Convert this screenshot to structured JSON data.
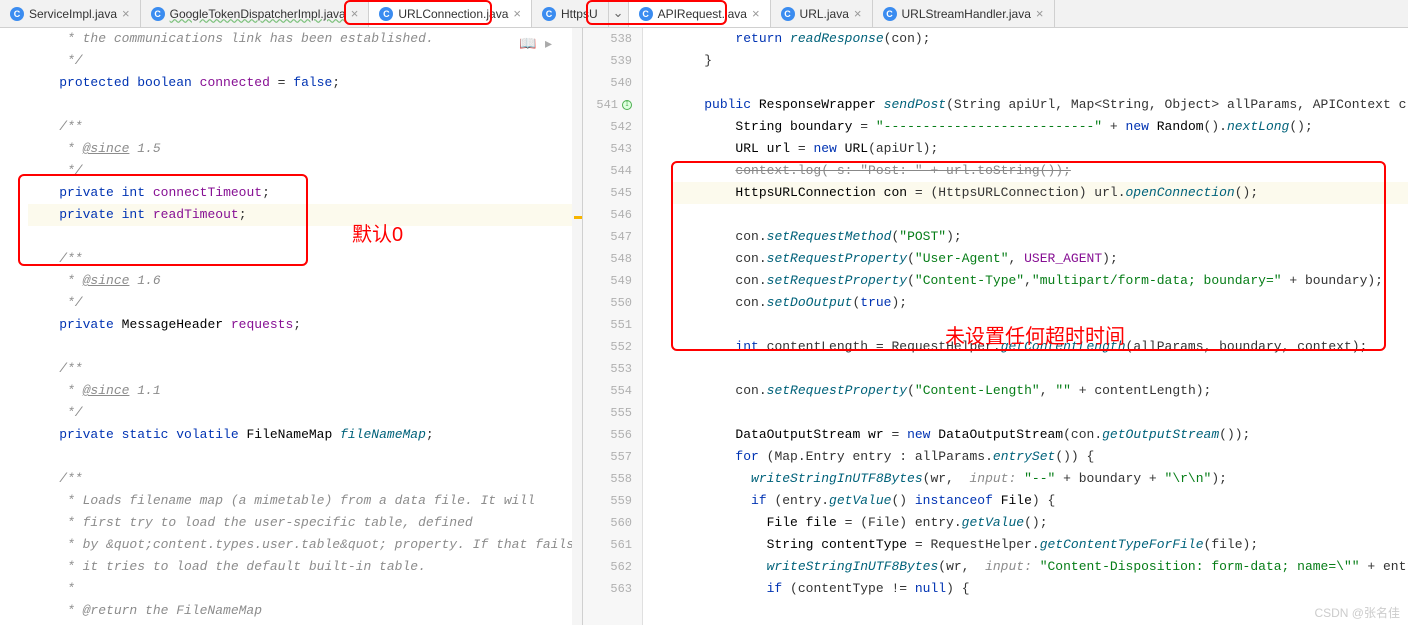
{
  "tabs_left": [
    {
      "label": "ServiceImpl.java",
      "active": false,
      "icon": "c"
    },
    {
      "label": "GoogleTokenDispatcherImpl.java",
      "active": false,
      "icon": "c",
      "underline": true
    },
    {
      "label": "URLConnection.java",
      "active": true,
      "icon": "c"
    },
    {
      "label": "HttpsU",
      "active": false,
      "icon": "c",
      "truncated": true
    }
  ],
  "tabs_right": [
    {
      "label": "APIRequest.java",
      "active": true,
      "icon": "c"
    },
    {
      "label": "URL.java",
      "active": false,
      "icon": "c"
    },
    {
      "label": "URLStreamHandler.java",
      "active": false,
      "icon": "c"
    }
  ],
  "annotation_left": "默认0",
  "annotation_right": "未设置任何超时时间",
  "watermark": "CSDN @张名佳",
  "right_lines": {
    "start": 538,
    "end": 563
  },
  "left_code": [
    {
      "t": "cmt",
      "text": "     * the communications link has been established."
    },
    {
      "t": "cmt",
      "text": "     */"
    },
    {
      "t": "code",
      "segs": [
        [
          "sp",
          "    "
        ],
        [
          "kw",
          "protected boolean"
        ],
        [
          "sp",
          " "
        ],
        [
          "fld",
          "connected"
        ],
        [
          "pl",
          " = "
        ],
        [
          "kw",
          "false"
        ],
        [
          "pl",
          ";"
        ]
      ]
    },
    {
      "t": "blank",
      "text": ""
    },
    {
      "t": "cmt",
      "text": "    /**"
    },
    {
      "t": "cmt",
      "text": "     * @since 1.5",
      "underline": "@since"
    },
    {
      "t": "cmt",
      "text": "     */"
    },
    {
      "t": "code",
      "segs": [
        [
          "sp",
          "    "
        ],
        [
          "kw",
          "private int"
        ],
        [
          "sp",
          " "
        ],
        [
          "fld",
          "connectTimeout"
        ],
        [
          "pl",
          ";"
        ]
      ]
    },
    {
      "t": "code",
      "segs": [
        [
          "sp",
          "    "
        ],
        [
          "kw",
          "private int"
        ],
        [
          "sp",
          " "
        ],
        [
          "fld",
          "readTimeout"
        ],
        [
          "pl",
          ";"
        ]
      ],
      "cursor": true,
      "hl": true
    },
    {
      "t": "blank",
      "text": ""
    },
    {
      "t": "cmt",
      "text": "    /**"
    },
    {
      "t": "cmt",
      "text": "     * @since 1.6",
      "underline": "@since"
    },
    {
      "t": "cmt",
      "text": "     */"
    },
    {
      "t": "code",
      "segs": [
        [
          "sp",
          "    "
        ],
        [
          "kw",
          "private"
        ],
        [
          "sp",
          " "
        ],
        [
          "ty",
          "MessageHeader "
        ],
        [
          "fld",
          "requests"
        ],
        [
          "pl",
          ";"
        ]
      ]
    },
    {
      "t": "blank",
      "text": ""
    },
    {
      "t": "cmt",
      "text": "    /**"
    },
    {
      "t": "cmt",
      "text": "     * @since 1.1",
      "underline": "@since"
    },
    {
      "t": "cmt",
      "text": "     */"
    },
    {
      "t": "code",
      "segs": [
        [
          "sp",
          "    "
        ],
        [
          "kw",
          "private static volatile"
        ],
        [
          "sp",
          " "
        ],
        [
          "ty",
          "FileNameMap "
        ],
        [
          "fn",
          "fileNameMap"
        ],
        [
          "pl",
          ";"
        ]
      ]
    },
    {
      "t": "blank",
      "text": ""
    },
    {
      "t": "cmt",
      "text": "    /**"
    },
    {
      "t": "cmt",
      "text": "     * Loads filename map (a mimetable) from a data file. It will"
    },
    {
      "t": "cmt",
      "text": "     * first try to load the user-specific table, defined"
    },
    {
      "t": "cmt",
      "text": "     * by &quot;content.types.user.table&quot; property. If that fails,"
    },
    {
      "t": "cmt",
      "text": "     * it tries to load the default built-in table."
    },
    {
      "t": "cmt",
      "text": "     *"
    },
    {
      "t": "cmt",
      "text": "     * @return the FileNameMap"
    }
  ],
  "right_code": [
    {
      "n": 538,
      "segs": [
        [
          "sp",
          "        "
        ],
        [
          "kw",
          "return"
        ],
        [
          "sp",
          " "
        ],
        [
          "fn",
          "readResponse"
        ],
        [
          "pl",
          "(con);"
        ]
      ]
    },
    {
      "n": 539,
      "segs": [
        [
          "sp",
          "    "
        ],
        [
          "pl",
          "}"
        ]
      ]
    },
    {
      "n": 540,
      "segs": [
        [
          "pl",
          ""
        ]
      ]
    },
    {
      "n": 541,
      "icon": "impl",
      "segs": [
        [
          "sp",
          "    "
        ],
        [
          "kw",
          "public"
        ],
        [
          "sp",
          " "
        ],
        [
          "ty",
          "ResponseWrapper "
        ],
        [
          "fn",
          "sendPost"
        ],
        [
          "pl",
          "(String apiUrl, Map<String, Object> allParams, APIContext c"
        ]
      ]
    },
    {
      "n": 542,
      "segs": [
        [
          "sp",
          "        "
        ],
        [
          "ty",
          "String boundary"
        ],
        [
          "pl",
          " = "
        ],
        [
          "str",
          "\"---------------------------\""
        ],
        [
          "pl",
          " + "
        ],
        [
          "kw",
          "new"
        ],
        [
          "sp",
          " "
        ],
        [
          "ty",
          "Random"
        ],
        [
          "pl",
          "()."
        ],
        [
          "fn",
          "nextLong"
        ],
        [
          "pl",
          "();"
        ]
      ]
    },
    {
      "n": 543,
      "segs": [
        [
          "sp",
          "        "
        ],
        [
          "ty",
          "URL url"
        ],
        [
          "pl",
          " = "
        ],
        [
          "kw",
          "new"
        ],
        [
          "sp",
          " "
        ],
        [
          "ty",
          "URL"
        ],
        [
          "pl",
          "(apiUrl);"
        ]
      ]
    },
    {
      "n": 544,
      "segs": [
        [
          "sp",
          "        "
        ],
        [
          "strike",
          "context.log( s: \"Post: \" + url.toString());"
        ]
      ]
    },
    {
      "n": 545,
      "hl": true,
      "segs": [
        [
          "sp",
          "        "
        ],
        [
          "ty",
          "HttpsURLConnection con"
        ],
        [
          "pl",
          " = (HttpsURLConnection) url."
        ],
        [
          "fn",
          "openConnection"
        ],
        [
          "pl",
          "();"
        ]
      ]
    },
    {
      "n": 546,
      "segs": [
        [
          "pl",
          ""
        ]
      ]
    },
    {
      "n": 547,
      "segs": [
        [
          "sp",
          "        "
        ],
        [
          "pl",
          "con."
        ],
        [
          "fn",
          "setRequestMethod"
        ],
        [
          "pl",
          "("
        ],
        [
          "str",
          "\"POST\""
        ],
        [
          "pl",
          ");"
        ]
      ]
    },
    {
      "n": 548,
      "segs": [
        [
          "sp",
          "        "
        ],
        [
          "pl",
          "con."
        ],
        [
          "fn",
          "setRequestProperty"
        ],
        [
          "pl",
          "("
        ],
        [
          "str",
          "\"User-Agent\""
        ],
        [
          "pl",
          ", "
        ],
        [
          "fld",
          "USER_AGENT"
        ],
        [
          "pl",
          ");"
        ]
      ]
    },
    {
      "n": 549,
      "segs": [
        [
          "sp",
          "        "
        ],
        [
          "pl",
          "con."
        ],
        [
          "fn",
          "setRequestProperty"
        ],
        [
          "pl",
          "("
        ],
        [
          "str",
          "\"Content-Type\""
        ],
        [
          "pl",
          ","
        ],
        [
          "str",
          "\"multipart/form-data; boundary=\""
        ],
        [
          "pl",
          " + boundary);"
        ]
      ]
    },
    {
      "n": 550,
      "segs": [
        [
          "sp",
          "        "
        ],
        [
          "pl",
          "con."
        ],
        [
          "fn",
          "setDoOutput"
        ],
        [
          "pl",
          "("
        ],
        [
          "kw",
          "true"
        ],
        [
          "pl",
          ");"
        ]
      ]
    },
    {
      "n": 551,
      "segs": [
        [
          "pl",
          ""
        ]
      ]
    },
    {
      "n": 552,
      "segs": [
        [
          "sp",
          "        "
        ],
        [
          "kw",
          "int"
        ],
        [
          "sp",
          " "
        ],
        [
          "pl",
          "contentLength = RequestHelper."
        ],
        [
          "fn",
          "getContentLength"
        ],
        [
          "pl",
          "(allParams, boundary, context);"
        ]
      ]
    },
    {
      "n": 553,
      "segs": [
        [
          "pl",
          ""
        ]
      ]
    },
    {
      "n": 554,
      "segs": [
        [
          "sp",
          "        "
        ],
        [
          "pl",
          "con."
        ],
        [
          "fn",
          "setRequestProperty"
        ],
        [
          "pl",
          "("
        ],
        [
          "str",
          "\"Content-Length\""
        ],
        [
          "pl",
          ", "
        ],
        [
          "str",
          "\"\""
        ],
        [
          "pl",
          " + contentLength);"
        ]
      ]
    },
    {
      "n": 555,
      "segs": [
        [
          "pl",
          ""
        ]
      ]
    },
    {
      "n": 556,
      "segs": [
        [
          "sp",
          "        "
        ],
        [
          "ty",
          "DataOutputStream wr"
        ],
        [
          "pl",
          " = "
        ],
        [
          "kw",
          "new"
        ],
        [
          "sp",
          " "
        ],
        [
          "ty",
          "DataOutputStream"
        ],
        [
          "pl",
          "(con."
        ],
        [
          "fn",
          "getOutputStream"
        ],
        [
          "pl",
          "());"
        ]
      ]
    },
    {
      "n": 557,
      "segs": [
        [
          "sp",
          "        "
        ],
        [
          "kw",
          "for"
        ],
        [
          "sp",
          " "
        ],
        [
          "pl",
          "(Map.Entry entry : allParams."
        ],
        [
          "fn",
          "entrySet"
        ],
        [
          "pl",
          "()) {"
        ]
      ]
    },
    {
      "n": 558,
      "segs": [
        [
          "sp",
          "          "
        ],
        [
          "fn",
          "writeStringInUTF8Bytes"
        ],
        [
          "pl",
          "(wr,  "
        ],
        [
          "param",
          "input:"
        ],
        [
          "sp",
          " "
        ],
        [
          "str",
          "\"--\""
        ],
        [
          "pl",
          " + boundary + "
        ],
        [
          "str",
          "\"\\r\\n\""
        ],
        [
          "pl",
          ");"
        ]
      ]
    },
    {
      "n": 559,
      "segs": [
        [
          "sp",
          "          "
        ],
        [
          "kw",
          "if"
        ],
        [
          "sp",
          " "
        ],
        [
          "pl",
          "(entry."
        ],
        [
          "fn",
          "getValue"
        ],
        [
          "pl",
          "() "
        ],
        [
          "kw",
          "instanceof"
        ],
        [
          "sp",
          " "
        ],
        [
          "ty",
          "File"
        ],
        [
          "pl",
          ") {"
        ]
      ]
    },
    {
      "n": 560,
      "segs": [
        [
          "sp",
          "            "
        ],
        [
          "ty",
          "File file"
        ],
        [
          "pl",
          " = (File) entry."
        ],
        [
          "fn",
          "getValue"
        ],
        [
          "pl",
          "();"
        ]
      ]
    },
    {
      "n": 561,
      "segs": [
        [
          "sp",
          "            "
        ],
        [
          "ty",
          "String contentType"
        ],
        [
          "pl",
          " = RequestHelper."
        ],
        [
          "fn",
          "getContentTypeForFile"
        ],
        [
          "pl",
          "(file);"
        ]
      ]
    },
    {
      "n": 562,
      "segs": [
        [
          "sp",
          "            "
        ],
        [
          "fn",
          "writeStringInUTF8Bytes"
        ],
        [
          "pl",
          "(wr,  "
        ],
        [
          "param",
          "input:"
        ],
        [
          "sp",
          " "
        ],
        [
          "str",
          "\"Content-Disposition: form-data; name=\\\"\""
        ],
        [
          "pl",
          " + entry.g"
        ]
      ]
    },
    {
      "n": 563,
      "segs": [
        [
          "sp",
          "            "
        ],
        [
          "kw",
          "if"
        ],
        [
          "sp",
          " "
        ],
        [
          "pl",
          "(contentType != "
        ],
        [
          "kw",
          "null"
        ],
        [
          "pl",
          ") {"
        ]
      ]
    }
  ]
}
